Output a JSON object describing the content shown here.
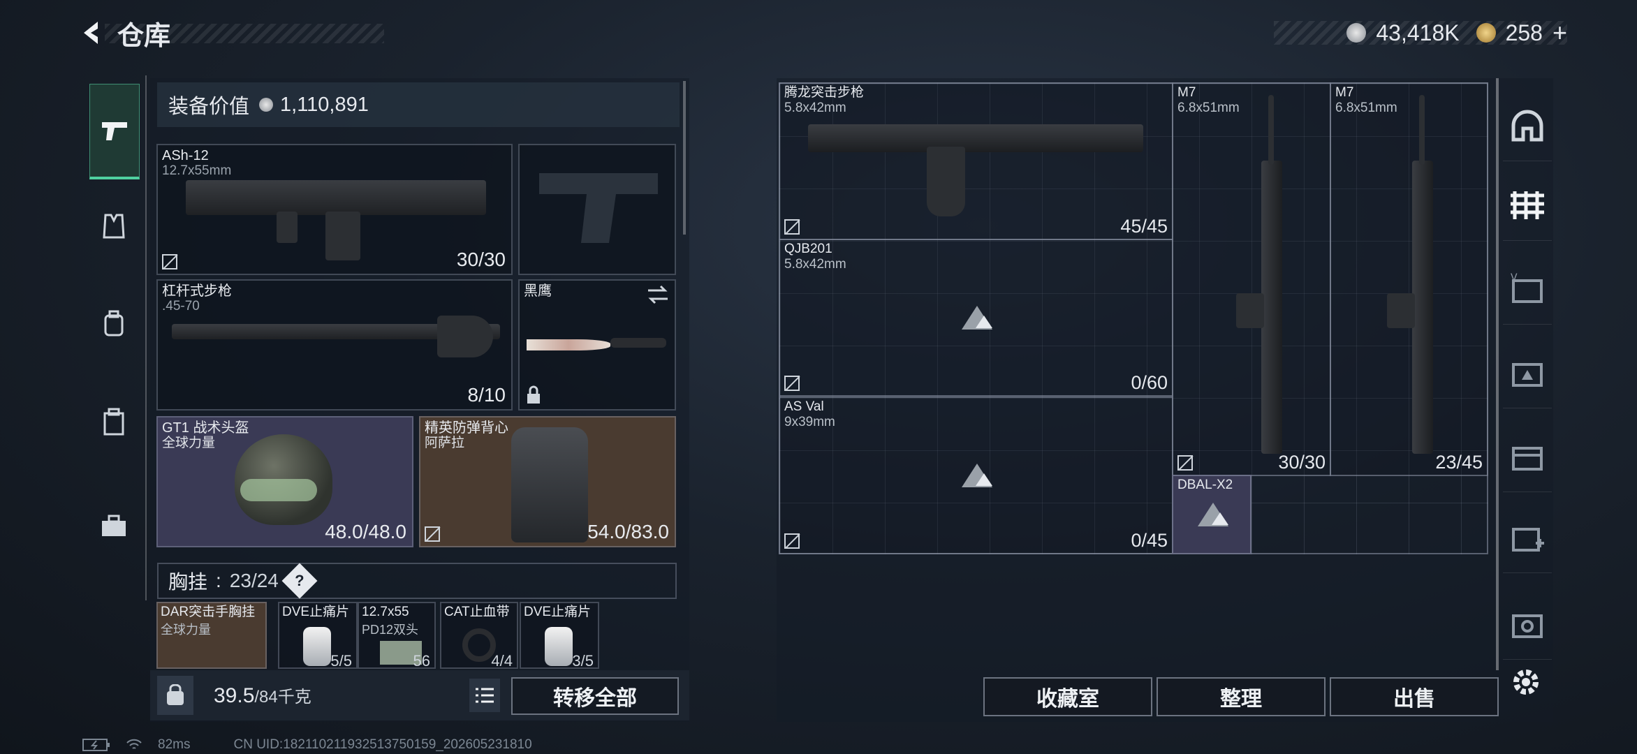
{
  "header": {
    "title": "仓库",
    "currency_primary": "43,418K",
    "currency_secondary": "258",
    "add_label": "+"
  },
  "left_nav": {
    "items": [
      {
        "icon": "pistol-icon",
        "active": true
      },
      {
        "icon": "vest-icon",
        "active": false
      },
      {
        "icon": "backpack-icon",
        "active": false
      },
      {
        "icon": "case-icon",
        "active": false
      },
      {
        "icon": "toolbox-icon",
        "active": false
      }
    ]
  },
  "loadout": {
    "value_label": "装备价值",
    "value": "1,110,891",
    "primary": {
      "name": "ASh-12",
      "caliber": "12.7x55mm",
      "ammo": "30/30"
    },
    "secondary": {
      "name": "杠杆式步枪",
      "caliber": ".45-70",
      "ammo": "8/10"
    },
    "melee": {
      "name": "黑鹰"
    },
    "helmet": {
      "name": "GT1 战术头盔",
      "sub": "全球力量",
      "durability": "48.0/48.0"
    },
    "armor": {
      "name": "精英防弹背心",
      "sub": "阿萨拉",
      "durability": "54.0/83.0"
    },
    "rig_label": "胸挂",
    "rig_capacity": "23/24",
    "help_label": "?",
    "rig_items": [
      {
        "name": "DAR突击手胸挂",
        "sub": "全球力量",
        "count": ""
      },
      {
        "name": "DVE止痛片",
        "sub": "",
        "count": "5/5"
      },
      {
        "name": "12.7x55",
        "sub": "PD12双头",
        "count": "56"
      },
      {
        "name": "CAT止血带",
        "sub": "",
        "count": "4/4"
      },
      {
        "name": "DVE止痛片",
        "sub": "",
        "count": "3/5"
      }
    ],
    "weight": "39.5",
    "weight_max": "/84千克",
    "transfer_all": "转移全部"
  },
  "storage": {
    "items": [
      {
        "name": "腾龙突击步枪",
        "caliber": "5.8x42mm",
        "ammo": "45/45"
      },
      {
        "name": "QJB201",
        "caliber": "5.8x42mm",
        "ammo": "0/60"
      },
      {
        "name": "AS Val",
        "caliber": "9x39mm",
        "ammo": "0/45"
      },
      {
        "name": "M7",
        "caliber": "6.8x51mm",
        "ammo": "30/30"
      },
      {
        "name": "M7",
        "caliber": "6.8x51mm",
        "ammo": "23/45"
      },
      {
        "name": "DBAL-X2"
      }
    ],
    "buttons": {
      "collection": "收藏室",
      "sort": "整理",
      "sell": "出售"
    }
  },
  "right_nav": {
    "items": [
      "safe-icon",
      "gun-rack-icon",
      "storage-v-icon",
      "storage-iii-icon",
      "storage-iv-icon",
      "medical-icon",
      "storage-iv2-icon"
    ]
  },
  "footer": {
    "ping": "82ms",
    "uid": "CN UID:18211021193251375015​9_202605231810"
  },
  "colors": {
    "accent": "#4fd0a0",
    "helmet_bg": "#3a3a55",
    "armor_bg": "#4a3b30",
    "rig_bg": "#4a3b30"
  }
}
